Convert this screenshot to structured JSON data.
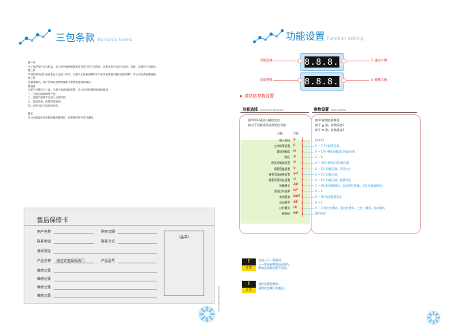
{
  "warranty": {
    "title_cn": "三包条款",
    "title_en": "Warranty terms",
    "paragraphs": [
      "第一条",
      "为了保护用户合法权益，本公司严格按照国家有关部门的三包规定，对售出的产品实行包修、包换、包退的三包服务。",
      "第二条",
      "本说明书所述产品自售出之日起一年内，凡属于正常使用情况下产品本身质量问题引起的故障，本公司负责免费维修。",
      "第三条",
      "在保修期内，用户凭购机发票和保修卡享受免费维修服务。",
      "第四条",
      "凡属下列情况之一者，不属于免费保修范围，本公司可酌情收取维修费用。",
      "一、已超过保修期的产品；",
      "二、因用户使用不当或人为损坏的；",
      "三、擅自拆装、修理或改装的；",
      "四、因不可抗力造成损坏的。",
      "备注",
      "本公司保留对本条款的最终解释权，如有更改恕不另行通知。"
    ],
    "vertical_text": "WWW.CHINA-BAIDA.COM"
  },
  "card": {
    "title": "售后保修卡",
    "fields": {
      "user_name": "用户名称",
      "purchase_date": "购买日期",
      "phone": "联系电话",
      "contact": "联系方式",
      "address": "通讯地址",
      "product_name": "产品名称",
      "product_name_value": "通过式金属探测门",
      "product_model": "产品型号",
      "repair": [
        "维修记录",
        "维修记录",
        "维修记录",
        "维修记录"
      ]
    },
    "stamp_label": "（盖章）"
  },
  "function": {
    "title_cn": "功能设置",
    "title_en": "Function setting",
    "panel_digits_top": "8.8.8.8.",
    "panel_digits_bottom": "8.8.8.8.",
    "labels": {
      "top_left": "功能选择",
      "bottom_left": "功能参数",
      "top_right": "① 通过人数",
      "bottom_right": "② 报警人数"
    },
    "section_title": "单防区参数设置:",
    "col1": {
      "title": "功能选择",
      "sub": "Functional selection"
    },
    "col2": {
      "title": "参数设置",
      "sub": "Spec setting"
    },
    "desc1": [
      "按PROG键进入编程状态",
      "按以下功能选项选择相应功能"
    ],
    "desc2": [
      "按UP键增加参数值",
      "按下 ▲ 键，参数值加1",
      "按下 ▼ 键，参数值减1"
    ],
    "table_head": {
      "func": "功能",
      "code": "代码"
    },
    "rows": [
      {
        "func": "输入密码",
        "code": "P",
        "desc": "PXXXX"
      },
      {
        "func": "工作频率设置",
        "code": "F",
        "desc": "0 ~ 7     7个频率可调"
      },
      {
        "func": "整体灵敏度",
        "code": "H",
        "desc": "0 ~ 100  整体灵敏度100级可调"
      },
      {
        "func": "防区",
        "code": "A",
        "desc": "0 ~ 6"
      },
      {
        "func": "防区灵敏度设置",
        "code": "X",
        "desc": "0 ~ 400  单防区400级可调"
      },
      {
        "func": "报警音量设置",
        "code": "y",
        "desc": "0 ~ 10    10级可调，声音大小"
      },
      {
        "func": "报警音调选择设置",
        "code": "yd",
        "desc": "0 ~ 10    10级可调"
      },
      {
        "func": "报警声音时长设置",
        "code": "d",
        "desc": "0 ~ 10    10级可调，报警时长"
      },
      {
        "func": "场景模式",
        "code": "AP",
        "desc": "1 ~ 66    66场景模式（安全登记等级，分区灵敏度模式）"
      },
      {
        "func": "双柱红外选择",
        "code": "LP",
        "desc": "0 ~ 1"
      },
      {
        "func": "电池容量",
        "code": "BAT",
        "desc": "0 ~ 99    电池容量显示"
      },
      {
        "func": "自动报率",
        "code": "AF",
        "desc": "0 ~ 1"
      },
      {
        "func": "红外模式",
        "code": "IR",
        "desc": "0 ~ 3     单红外模式，双红外模式，三合一模式，双向模式"
      },
      {
        "func": "新密码",
        "code": "NP",
        "desc": "NP0000"
      }
    ],
    "warnings": [
      {
        "badge": "注 意",
        "text": [
          "在进入下一界面时，",
          "上一界面参数将自动保存，",
          "断电后参数设置不丢失。"
        ]
      },
      {
        "badge": "注 意",
        "text": [
          "请在设置参数时，",
          "请勿在金属门内通过。"
        ]
      }
    ]
  }
}
